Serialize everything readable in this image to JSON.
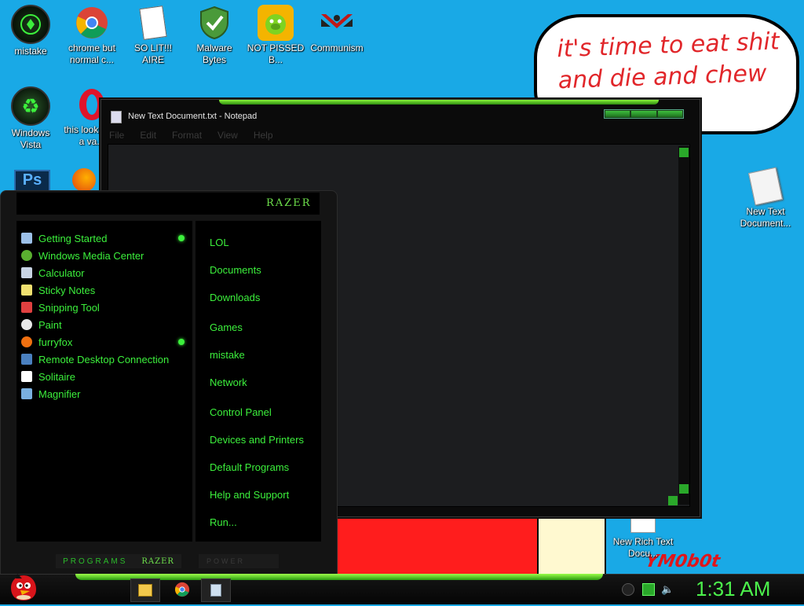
{
  "desktop": {
    "icons": [
      {
        "label": "mistake",
        "icon": "razer-icon"
      },
      {
        "label": "chrome but normal c...",
        "icon": "chrome-icon"
      },
      {
        "label": "SO LIT!!! AIRE",
        "icon": "solitaire-icon"
      },
      {
        "label": "Malware Bytes",
        "icon": "shield-check-icon"
      },
      {
        "label": "NOT PISSED B...",
        "icon": "angry-pig-icon"
      },
      {
        "label": "Communism",
        "icon": "communism-logo-icon"
      },
      {
        "label": "Windows Vista",
        "icon": "recycle-icon"
      },
      {
        "label": "this looks like a va...",
        "icon": "opera-icon"
      },
      {
        "label": "New Text Document...",
        "icon": "text-document-icon"
      },
      {
        "label": "New Rich Text Docu...",
        "icon": "rich-text-document-icon"
      }
    ],
    "bubble_text": "it's time to eat shit and die and chew",
    "graffiti": "YM0b0t"
  },
  "notepad": {
    "title": "New Text Document.txt - Notepad",
    "menu": [
      "File",
      "Edit",
      "Format",
      "View",
      "Help"
    ]
  },
  "start_menu": {
    "logo": "RAZER",
    "programs": [
      {
        "label": "Getting Started",
        "has_arrow": true
      },
      {
        "label": "Windows Media Center",
        "has_arrow": false
      },
      {
        "label": "Calculator",
        "has_arrow": false
      },
      {
        "label": "Sticky Notes",
        "has_arrow": false
      },
      {
        "label": "Snipping Tool",
        "has_arrow": false
      },
      {
        "label": "Paint",
        "has_arrow": false
      },
      {
        "label": "furryfox",
        "has_arrow": true
      },
      {
        "label": "Remote Desktop Connection",
        "has_arrow": false
      },
      {
        "label": "Solitaire",
        "has_arrow": false
      },
      {
        "label": "Magnifier",
        "has_arrow": false
      }
    ],
    "places": [
      "LOL",
      "Documents",
      "Downloads",
      "Games",
      "mistake",
      "Network",
      "Control Panel",
      "Devices and Printers",
      "Default Programs",
      "Help and Support",
      "Run..."
    ],
    "all_programs_label": "PROGRAMS",
    "all_programs_logo": "RAZER",
    "power_label": "POWER"
  },
  "taskbar": {
    "clock": "1:31 AM"
  },
  "colors": {
    "desktop_bg": "#19a9e6",
    "accent_green": "#3cf03c",
    "bubble_text": "#e1262a"
  }
}
